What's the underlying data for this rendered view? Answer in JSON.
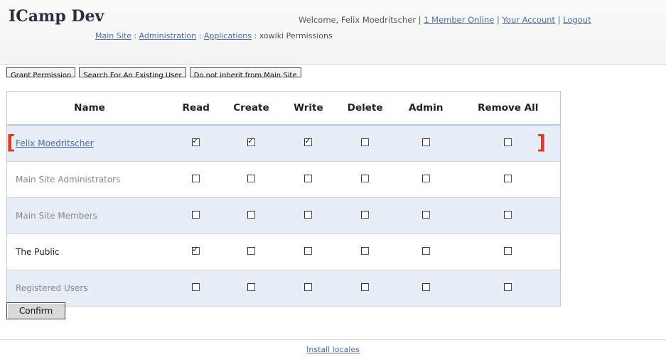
{
  "header": {
    "app_title": "ICamp Dev",
    "welcome": "Welcome, Felix Moedritscher",
    "separator": "|",
    "members_online": "1 Member Online",
    "your_account": "Your Account",
    "logout": "Logout"
  },
  "breadcrumb": {
    "main_site": "Main Site",
    "administration": "Administration",
    "applications": "Applications",
    "current": "xowiki Permissions",
    "sep": ":"
  },
  "toolbar": {
    "grant_permission": "Grant Permission",
    "search_user": "Search For An Existing User",
    "do_not_inherit": "Do not inherit from Main Site"
  },
  "table": {
    "columns": [
      "Name",
      "Read",
      "Create",
      "Write",
      "Delete",
      "Admin",
      "Remove All"
    ],
    "rows": [
      {
        "name": "Felix Moedritscher",
        "link": true,
        "highlight": true,
        "checks": [
          true,
          true,
          true,
          false,
          false,
          false
        ]
      },
      {
        "name": "Main Site Administrators",
        "link": false,
        "checks": [
          false,
          false,
          false,
          false,
          false,
          false
        ]
      },
      {
        "name": "Main Site Members",
        "link": false,
        "checks": [
          false,
          false,
          false,
          false,
          false,
          false
        ]
      },
      {
        "name": "The Public",
        "link": false,
        "dark": true,
        "checks": [
          true,
          false,
          false,
          false,
          false,
          false
        ]
      },
      {
        "name": "Registered Users",
        "link": false,
        "checks": [
          false,
          false,
          false,
          false,
          false,
          false
        ]
      }
    ]
  },
  "confirm_label": "Confirm",
  "footer": {
    "install_locales": "Install locales"
  },
  "colors": {
    "link": "#4a6ea8",
    "highlight_bracket": "#e63a1f",
    "row_shade": "#e6edf6"
  }
}
